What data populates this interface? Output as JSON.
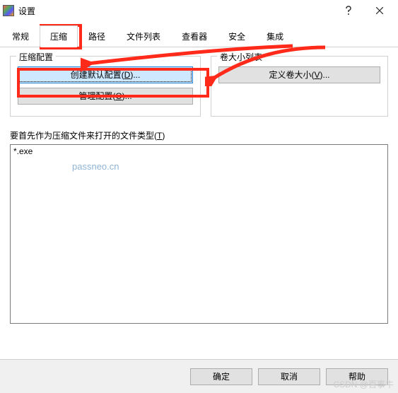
{
  "titlebar": {
    "title": "设置"
  },
  "tabs": {
    "items": [
      {
        "label": "常规"
      },
      {
        "label": "压缩"
      },
      {
        "label": "路径"
      },
      {
        "label": "文件列表"
      },
      {
        "label": "查看器"
      },
      {
        "label": "安全"
      },
      {
        "label": "集成"
      }
    ],
    "activeIndex": 1
  },
  "compressGroup": {
    "legend": "压缩配置",
    "createDefault": "创建默认配置(",
    "createDefault_u": "D",
    "createDefault_suffix": ")...",
    "manage": "管理配置(",
    "manage_u": "O",
    "manage_suffix": ")..."
  },
  "volumeGroup": {
    "legend": "卷大小列表",
    "define": "定义卷大小(",
    "define_u": "V",
    "define_suffix": ")..."
  },
  "fileTypes": {
    "label_pre": "要首先作为压缩文件来打开的文件类型(",
    "label_u": "T",
    "label_suf": ")",
    "value": "*.exe"
  },
  "buttons": {
    "ok": "确定",
    "cancel": "取消",
    "help": "帮助"
  },
  "watermark": "passneo.cn",
  "csdn": "CSDN @百事牛"
}
